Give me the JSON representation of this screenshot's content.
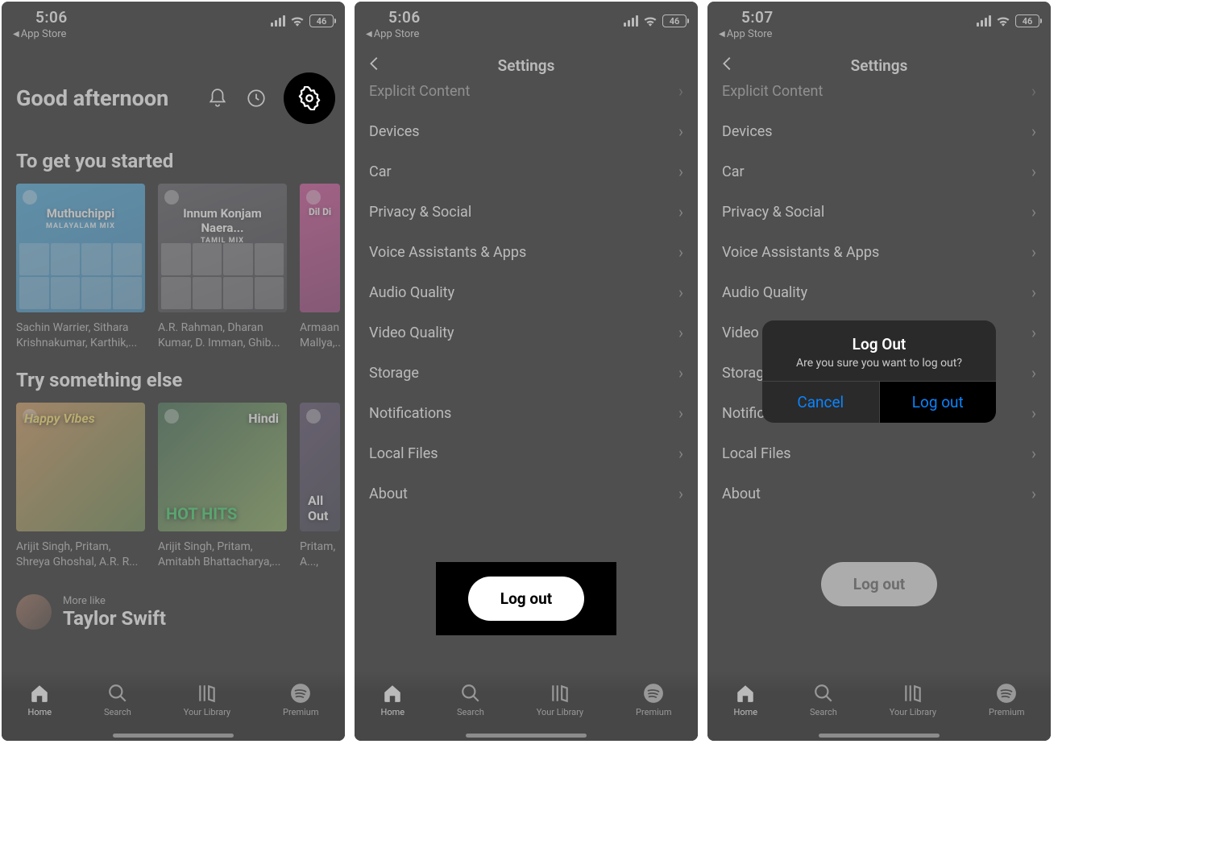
{
  "status": {
    "time_a": "5:06",
    "time_b": "5:06",
    "time_c": "5:07",
    "back_app": "App Store",
    "battery": "46"
  },
  "home": {
    "greeting": "Good afternoon",
    "section1_title": "To get you started",
    "section2_title": "Try something else",
    "cards1": [
      {
        "title": "Muthuchippi",
        "subtitle": "MALAYALAM MIX",
        "caption": "Sachin Warrier, Sithara Krishnakumar, Karthik,..."
      },
      {
        "title": "Innum Konjam Naera...",
        "subtitle": "TAMIL MIX",
        "caption": "A.R. Rahman, Dharan Kumar, D. Imman, Ghib..."
      },
      {
        "title": "Dil Di",
        "subtitle": "",
        "caption": "Armaan Mallya,..."
      }
    ],
    "cards2": [
      {
        "label": "Happy Vibes",
        "caption": "Arijit Singh, Pritam, Shreya Ghoshal, A.R. R..."
      },
      {
        "label": "Hindi",
        "sublabel": "HOT HITS",
        "caption": "Arijit Singh, Pritam, Amitabh Bhattacharya,..."
      },
      {
        "label": "All Out",
        "caption": "Pritam, A..., Shreya G..."
      }
    ],
    "more_like_top": "More like",
    "more_like_name": "Taylor Swift"
  },
  "settings": {
    "title": "Settings",
    "items": [
      "Explicit Content",
      "Devices",
      "Car",
      "Privacy & Social",
      "Voice Assistants & Apps",
      "Audio Quality",
      "Video Quality",
      "Storage",
      "Notifications",
      "Local Files",
      "About"
    ],
    "logout": "Log out"
  },
  "dialog": {
    "title": "Log Out",
    "message": "Are you sure you want to log out?",
    "cancel": "Cancel",
    "confirm": "Log out"
  },
  "nav": {
    "home": "Home",
    "search": "Search",
    "library": "Your Library",
    "premium": "Premium"
  }
}
